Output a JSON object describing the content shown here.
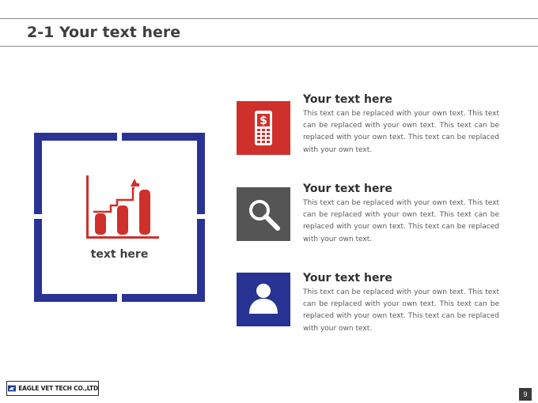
{
  "slide": {
    "title": "2-1 Your text here"
  },
  "panel": {
    "caption": "text here"
  },
  "items": [
    {
      "title": "Your text here",
      "body": "This text can be replaced with your own text. This text can be replaced with your own text. This text can be replaced with your own text. This text can be replaced with your own text.",
      "icon": "mobile-phone-dollar-icon",
      "color": "#d0302c"
    },
    {
      "title": "Your text here",
      "body": "This text can be replaced with your own text. This text can be replaced with your own text. This text can be replaced with your own text. This text can be replaced with your own text.",
      "icon": "magnifier-icon",
      "color": "#555555"
    },
    {
      "title": "Your text here",
      "body": "This text can be replaced with your own text. This text can be replaced with your own text. This text can be replaced with your own text. This text can be replaced with your own text.",
      "icon": "person-icon",
      "color": "#283393"
    }
  ],
  "footer": {
    "logo_text": "EAGLE VET TECH CO.,LTD",
    "page_number": "9"
  },
  "colors": {
    "accent_red": "#d0302c",
    "accent_blue": "#283393",
    "accent_gray": "#555555"
  }
}
